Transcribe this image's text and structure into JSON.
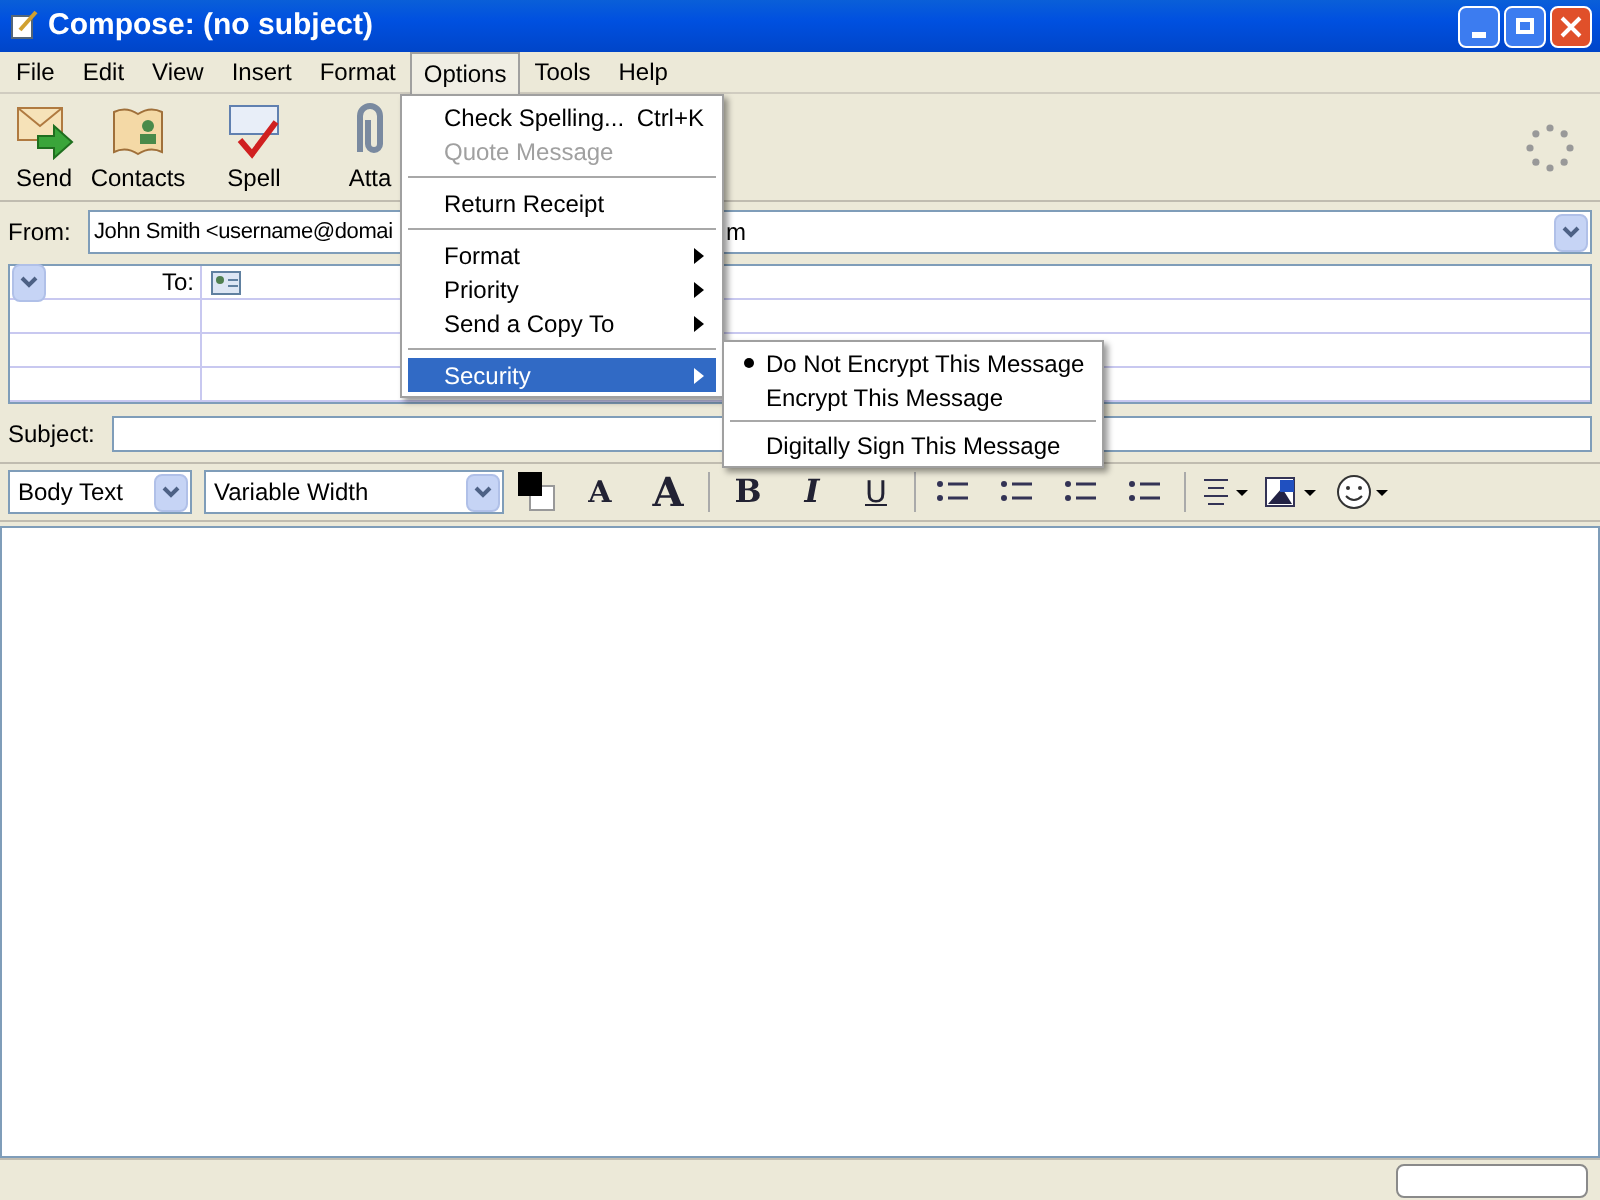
{
  "window": {
    "title": "Compose: (no subject)"
  },
  "menubar": [
    {
      "label": "File",
      "selected": false
    },
    {
      "label": "Edit",
      "selected": false
    },
    {
      "label": "View",
      "selected": false
    },
    {
      "label": "Insert",
      "selected": false
    },
    {
      "label": "Format",
      "selected": false
    },
    {
      "label": "Options",
      "selected": true
    },
    {
      "label": "Tools",
      "selected": false
    },
    {
      "label": "Help",
      "selected": false
    }
  ],
  "toolbar": [
    {
      "label": "Send",
      "kind": "send"
    },
    {
      "label": "Contacts",
      "kind": "contacts"
    },
    {
      "label": "Spell",
      "kind": "spell"
    },
    {
      "label": "Atta",
      "kind": "attach"
    }
  ],
  "from": {
    "label": "From:",
    "value": "John Smith <username@domai",
    "value_end": "m"
  },
  "addressing": {
    "rows": [
      {
        "type": "To:"
      },
      {
        "type": ""
      },
      {
        "type": ""
      },
      {
        "type": ""
      }
    ]
  },
  "subject": {
    "label": "Subject:"
  },
  "format_toolbar": {
    "paragraph": "Body Text",
    "font": "Variable Width",
    "smaller": "A",
    "larger": "A",
    "bold": "B",
    "italic": "I",
    "underline": "U"
  },
  "options_menu": [
    {
      "kind": "item",
      "label": "Check Spelling...",
      "shortcut": "Ctrl+K",
      "disabled": false,
      "selected": false,
      "submenu": false
    },
    {
      "kind": "item",
      "label": "Quote Message",
      "disabled": true,
      "selected": false,
      "submenu": false
    },
    {
      "kind": "separator"
    },
    {
      "kind": "item",
      "label": "Return Receipt",
      "disabled": false,
      "selected": false,
      "submenu": false
    },
    {
      "kind": "separator"
    },
    {
      "kind": "item",
      "label": "Format",
      "disabled": false,
      "selected": false,
      "submenu": true
    },
    {
      "kind": "item",
      "label": "Priority",
      "disabled": false,
      "selected": false,
      "submenu": true
    },
    {
      "kind": "item",
      "label": "Send a Copy To",
      "disabled": false,
      "selected": false,
      "submenu": true
    },
    {
      "kind": "separator"
    },
    {
      "kind": "item",
      "label": "Security",
      "disabled": false,
      "selected": true,
      "submenu": true
    }
  ],
  "security_menu": [
    {
      "kind": "item",
      "label": "Do Not Encrypt This Message",
      "checked": true
    },
    {
      "kind": "item",
      "label": "Encrypt This Message",
      "checked": false
    },
    {
      "kind": "separator"
    },
    {
      "kind": "item",
      "label": "Digitally Sign This Message",
      "checked": false
    }
  ]
}
